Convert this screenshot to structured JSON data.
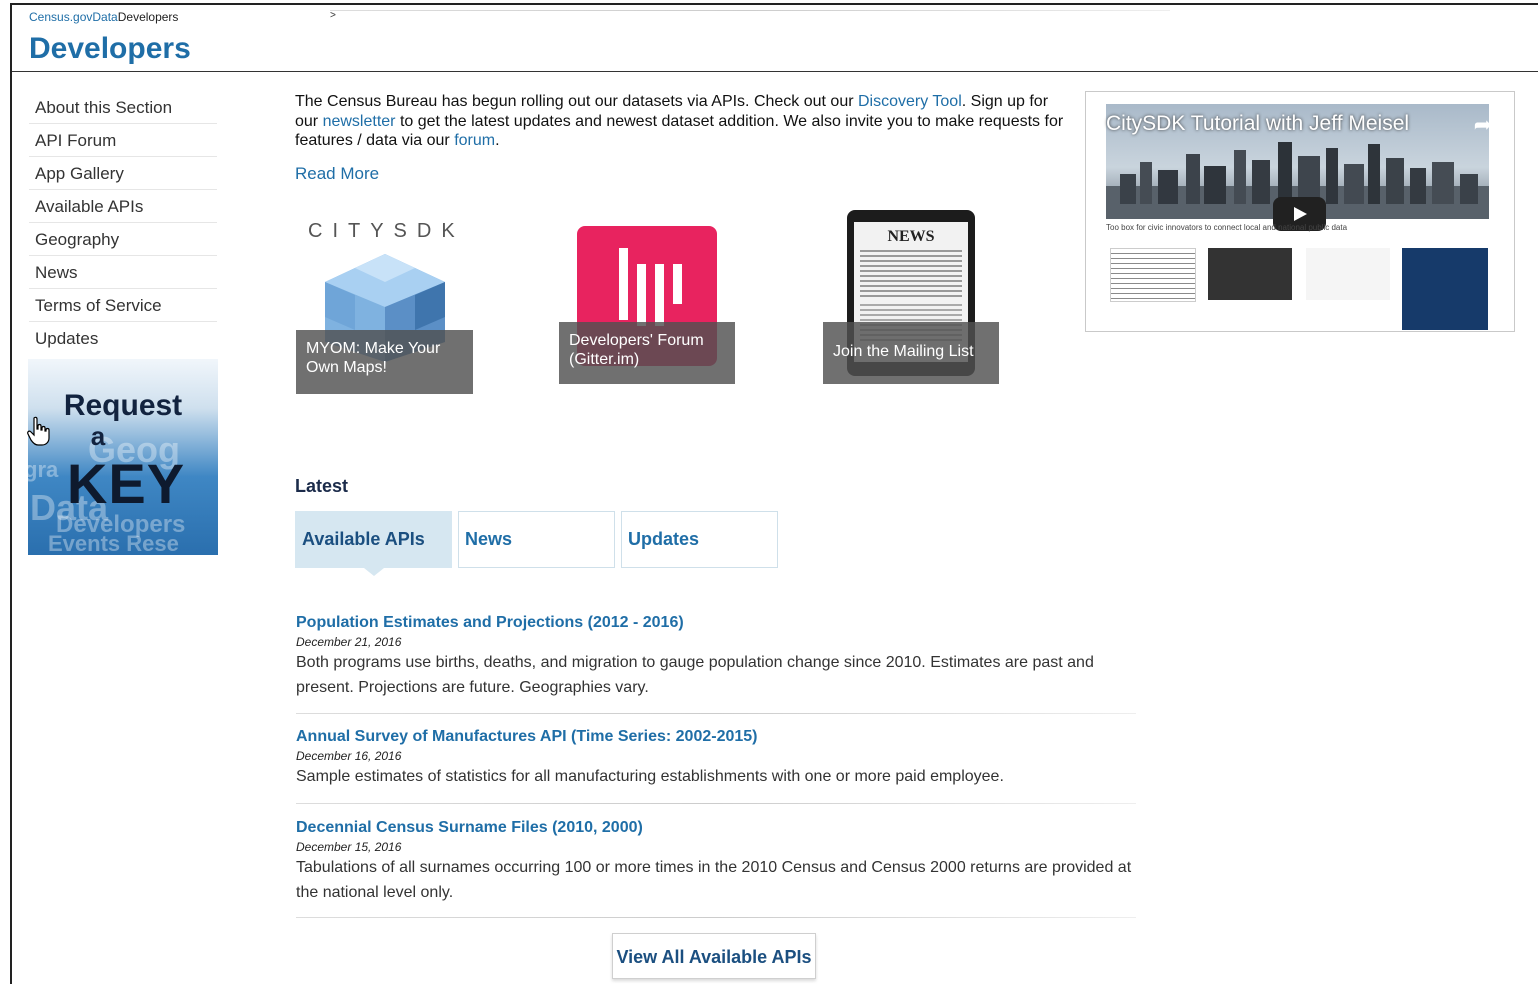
{
  "breadcrumb": {
    "items": [
      "Census.gov",
      "Data",
      "Developers"
    ]
  },
  "page_title": "Developers",
  "sidebar": {
    "items": [
      {
        "label": "About this Section"
      },
      {
        "label": "API Forum"
      },
      {
        "label": "App Gallery"
      },
      {
        "label": "Available APIs"
      },
      {
        "label": "Geography"
      },
      {
        "label": "News"
      },
      {
        "label": "Terms of Service"
      },
      {
        "label": "Updates"
      }
    ],
    "key_banner": {
      "line1": "Request",
      "line2": "a",
      "line3": "KEY"
    }
  },
  "intro": {
    "part1": "The Census Bureau has begun rolling out our datasets via APIs.  Check out our ",
    "link1": "Discovery Tool",
    "part2": ". Sign up for our ",
    "link2": "newsletter",
    "part3": " to get the latest updates and newest dataset addition. We also invite you to make requests for features / data via our ",
    "link3": "forum",
    "part4": ".",
    "read_more": "Read More"
  },
  "tiles": [
    {
      "caption": "MYOM: Make Your Own Maps!",
      "logo": "CITYSDK"
    },
    {
      "caption": "Developers' Forum (Gitter.im)"
    },
    {
      "caption": "Join the Mailing List",
      "logo": "NEWS"
    }
  ],
  "video": {
    "title": "CitySDK Tutorial with Jeff Meisel",
    "tagline": "Too box for civic innovators to connect local and national public data"
  },
  "latest": {
    "heading": "Latest",
    "tabs": [
      {
        "label": "Available APIs",
        "active": true
      },
      {
        "label": "News",
        "active": false
      },
      {
        "label": "Updates",
        "active": false
      }
    ],
    "entries": [
      {
        "title": "Population Estimates and Projections (2012 - 2016)",
        "date": "December 21, 2016",
        "description": "Both programs use births, deaths, and migration to gauge population change since 2010. Estimates are past and present. Projections are future. Geographies vary."
      },
      {
        "title": "Annual Survey of Manufactures API (Time Series: 2002-2015)",
        "date": "December 16, 2016",
        "description": "Sample estimates of statistics for all manufacturing establishments with one or more paid employee."
      },
      {
        "title": "Decennial Census Surname Files (2010, 2000)",
        "date": "December 15, 2016",
        "description": "Tabulations of all surnames occurring 100 or more times in the 2010 Census and Census 2000 returns are provided at the national level only."
      }
    ],
    "view_all": "View All Available APIs"
  },
  "colors": {
    "link": "#1f6ea7",
    "tab_active": "#d6e7f1",
    "gitter": "#e8235f"
  }
}
